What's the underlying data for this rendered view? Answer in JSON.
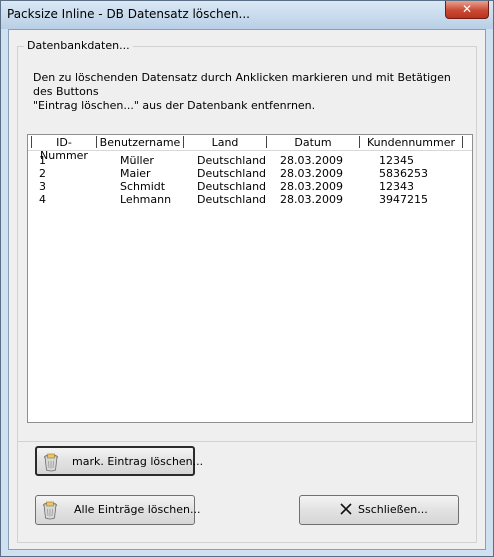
{
  "window": {
    "title": "Packsize Inline - DB Datensatz löschen..."
  },
  "group": {
    "label": "Datenbankdaten...",
    "description_line1": "Den zu löschenden Datensatz durch Anklicken markieren und mit Betätigen des Buttons",
    "description_line2": "\"Eintrag löschen...\" aus der Datenbank entfenrnen."
  },
  "table": {
    "columns": [
      "ID-Nummer",
      "Benutzername",
      "Land",
      "Datum",
      "Kundennummer"
    ],
    "rows": [
      [
        "1",
        "Müller",
        "Deutschland",
        "28.03.2009",
        "12345"
      ],
      [
        "2",
        "Maier",
        "Deutschland",
        "28.03.2009",
        "5836253"
      ],
      [
        "3",
        "Schmidt",
        "Deutschland",
        "28.03.2009",
        "12343"
      ],
      [
        "4",
        "Lehmann",
        "Deutschland",
        "28.03.2009",
        "3947215"
      ]
    ]
  },
  "buttons": {
    "delete_marked": "mark. Eintrag löschen...",
    "delete_all": "Alle Einträge löschen...",
    "close": "Sschließen..."
  },
  "colors": {
    "close_button": "#c94a34",
    "titlebar": "#c9dbee"
  }
}
